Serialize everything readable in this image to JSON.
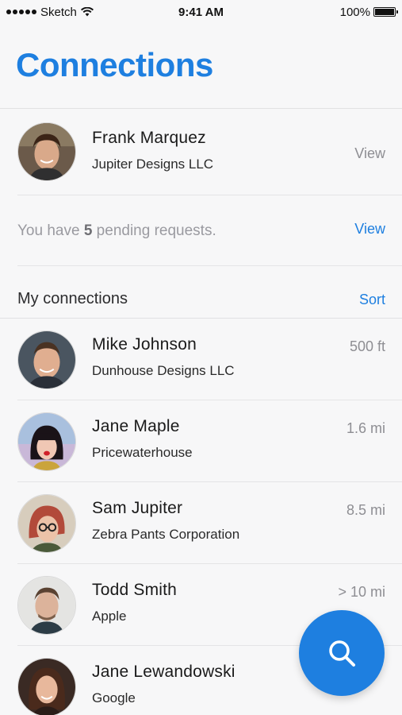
{
  "status_bar": {
    "carrier": "Sketch",
    "time": "9:41 AM",
    "battery": "100%",
    "icons": [
      "signal-dots-icon",
      "wifi-icon",
      "battery-icon"
    ]
  },
  "header": {
    "title": "Connections"
  },
  "featured": {
    "name": "Frank Marquez",
    "company": "Jupiter Designs LLC",
    "action": "View",
    "avatar": "frank-avatar"
  },
  "pending": {
    "prefix": "You have ",
    "count": "5",
    "suffix": " pending requests.",
    "action": "View"
  },
  "section": {
    "title": "My connections",
    "action": "Sort"
  },
  "connections": [
    {
      "name": "Mike Johnson",
      "company": "Dunhouse Designs LLC",
      "distance": "500 ft",
      "avatar": "mike-avatar"
    },
    {
      "name": "Jane Maple",
      "company": "Pricewaterhouse",
      "distance": "1.6 mi",
      "avatar": "jane-maple-avatar"
    },
    {
      "name": "Sam Jupiter",
      "company": "Zebra Pants Corporation",
      "distance": "8.5 mi",
      "avatar": "sam-avatar"
    },
    {
      "name": "Todd Smith",
      "company": "Apple",
      "distance": "> 10 mi",
      "avatar": "todd-avatar"
    },
    {
      "name": "Jane Lewandowski",
      "company": "Google",
      "distance": "",
      "avatar": "jane-lewandowski-avatar"
    }
  ],
  "fab": {
    "icon": "search-icon"
  },
  "colors": {
    "accent": "#1e7fe0",
    "background": "#f7f7f8",
    "secondary_text": "#8e8e93"
  }
}
